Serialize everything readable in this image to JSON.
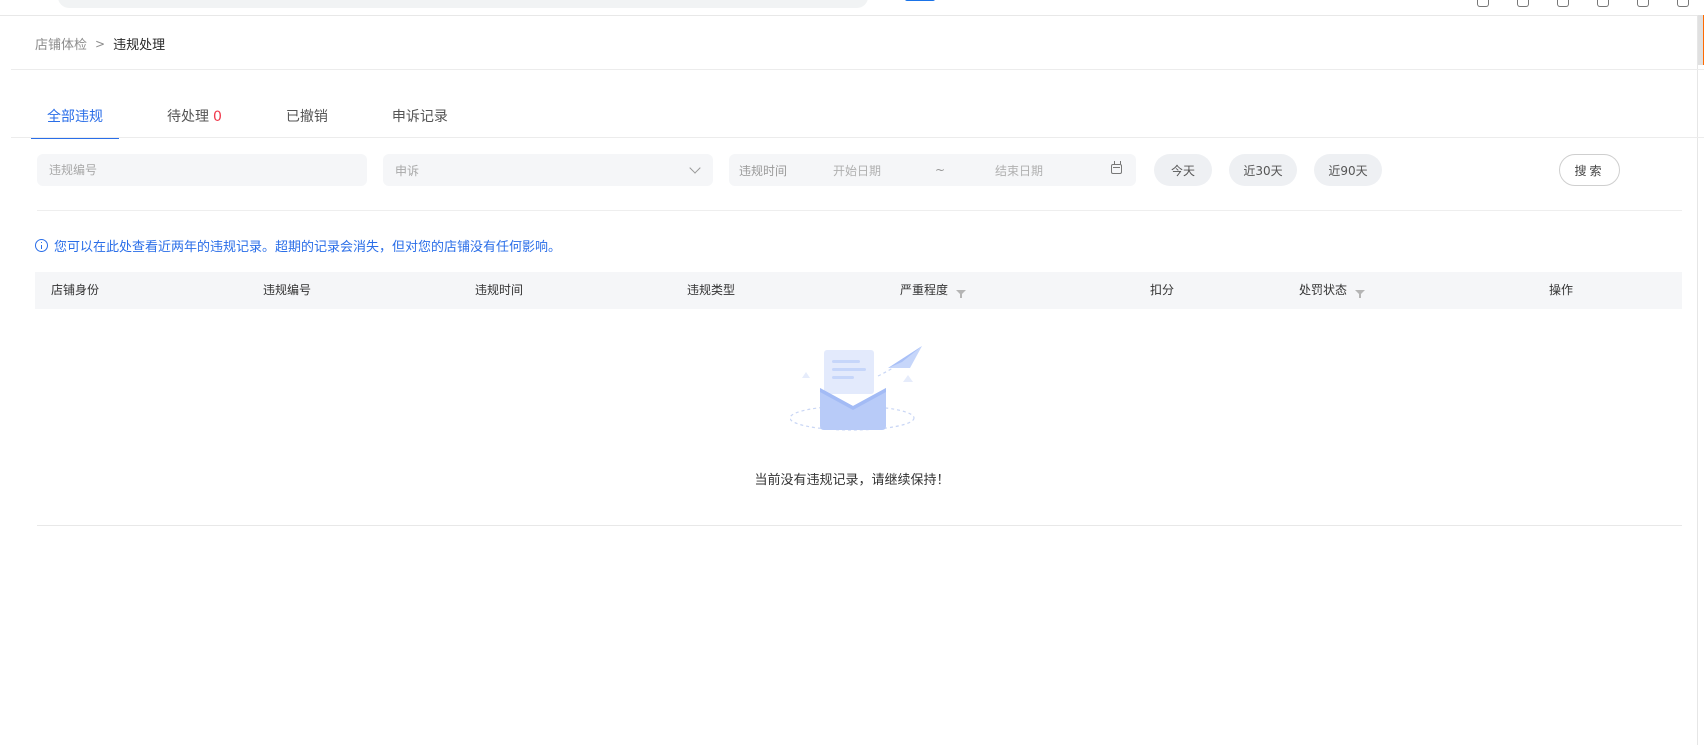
{
  "breadcrumb": {
    "parent": "店铺体检",
    "separator": ">",
    "current": "违规处理"
  },
  "tabs": [
    {
      "label": "全部违规",
      "active": true
    },
    {
      "label": "待处理",
      "count": "0"
    },
    {
      "label": "已撤销"
    },
    {
      "label": "申诉记录"
    }
  ],
  "filters": {
    "violation_id_placeholder": "违规编号",
    "appeal_select_value": "申诉",
    "date_label": "违规时间",
    "start_placeholder": "开始日期",
    "range_separator": "~",
    "end_placeholder": "结束日期",
    "quick_ranges": [
      "今天",
      "近30天",
      "近90天"
    ],
    "search_label": "搜索"
  },
  "notice": "您可以在此处查看近两年的违规记录。超期的记录会消失，但对您的店铺没有任何影响。",
  "table": {
    "columns": [
      "店铺身份",
      "违规编号",
      "违规时间",
      "违规类型",
      "严重程度",
      "扣分",
      "处罚状态",
      "操作"
    ],
    "rows": []
  },
  "empty_state": "当前没有违规记录，请继续保持！",
  "colors": {
    "accent": "#2a6ee8",
    "danger": "#f0384b",
    "header_bg": "#f5f6f8"
  }
}
